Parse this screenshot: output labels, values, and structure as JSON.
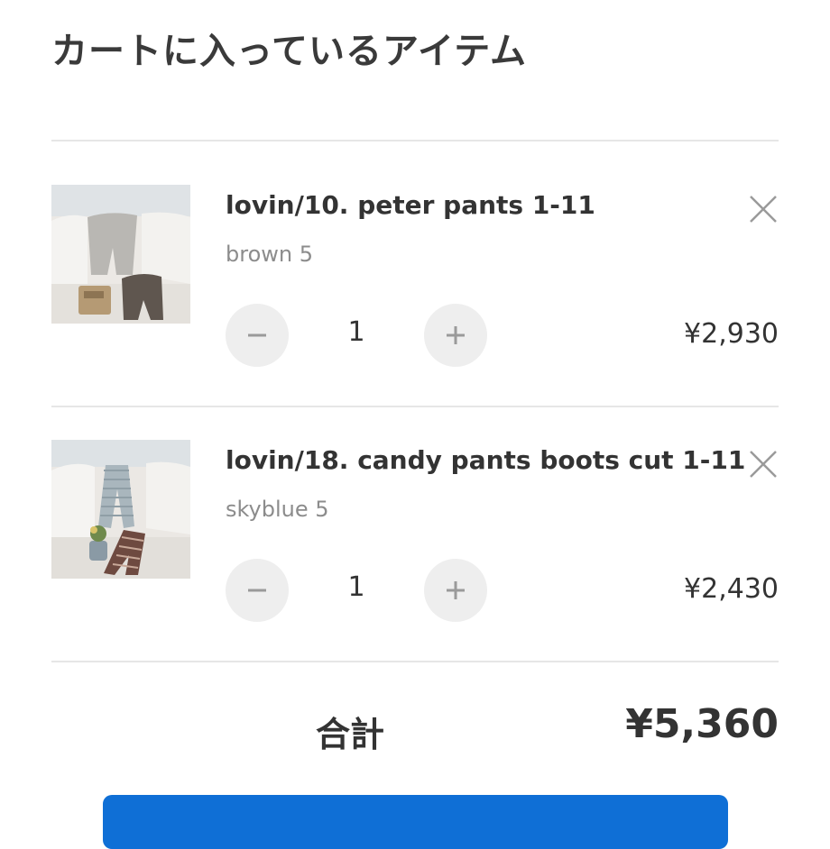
{
  "header": {
    "title": "カートに入っているアイテム"
  },
  "cart": {
    "items": [
      {
        "name": "lovin/10. peter pants 1-11",
        "variant": "brown 5",
        "quantity": "1",
        "price": "¥2,930",
        "image_icon": "product-photo-pants",
        "remove_icon": "close-icon"
      },
      {
        "name": "lovin/18. candy pants boots cut 1-11",
        "variant": "skyblue 5",
        "quantity": "1",
        "price": "¥2,430",
        "image_icon": "product-photo-pants",
        "remove_icon": "close-icon"
      }
    ],
    "stepper": {
      "minus_icon": "minus-icon",
      "plus_icon": "plus-icon"
    }
  },
  "summary": {
    "total_label": "合計",
    "total_value": "¥5,360"
  },
  "colors": {
    "accent": "#0f6fd6",
    "stepper_bg": "#eeeeee",
    "divider": "#e6e6e6",
    "muted_text": "#8c8c8c"
  }
}
